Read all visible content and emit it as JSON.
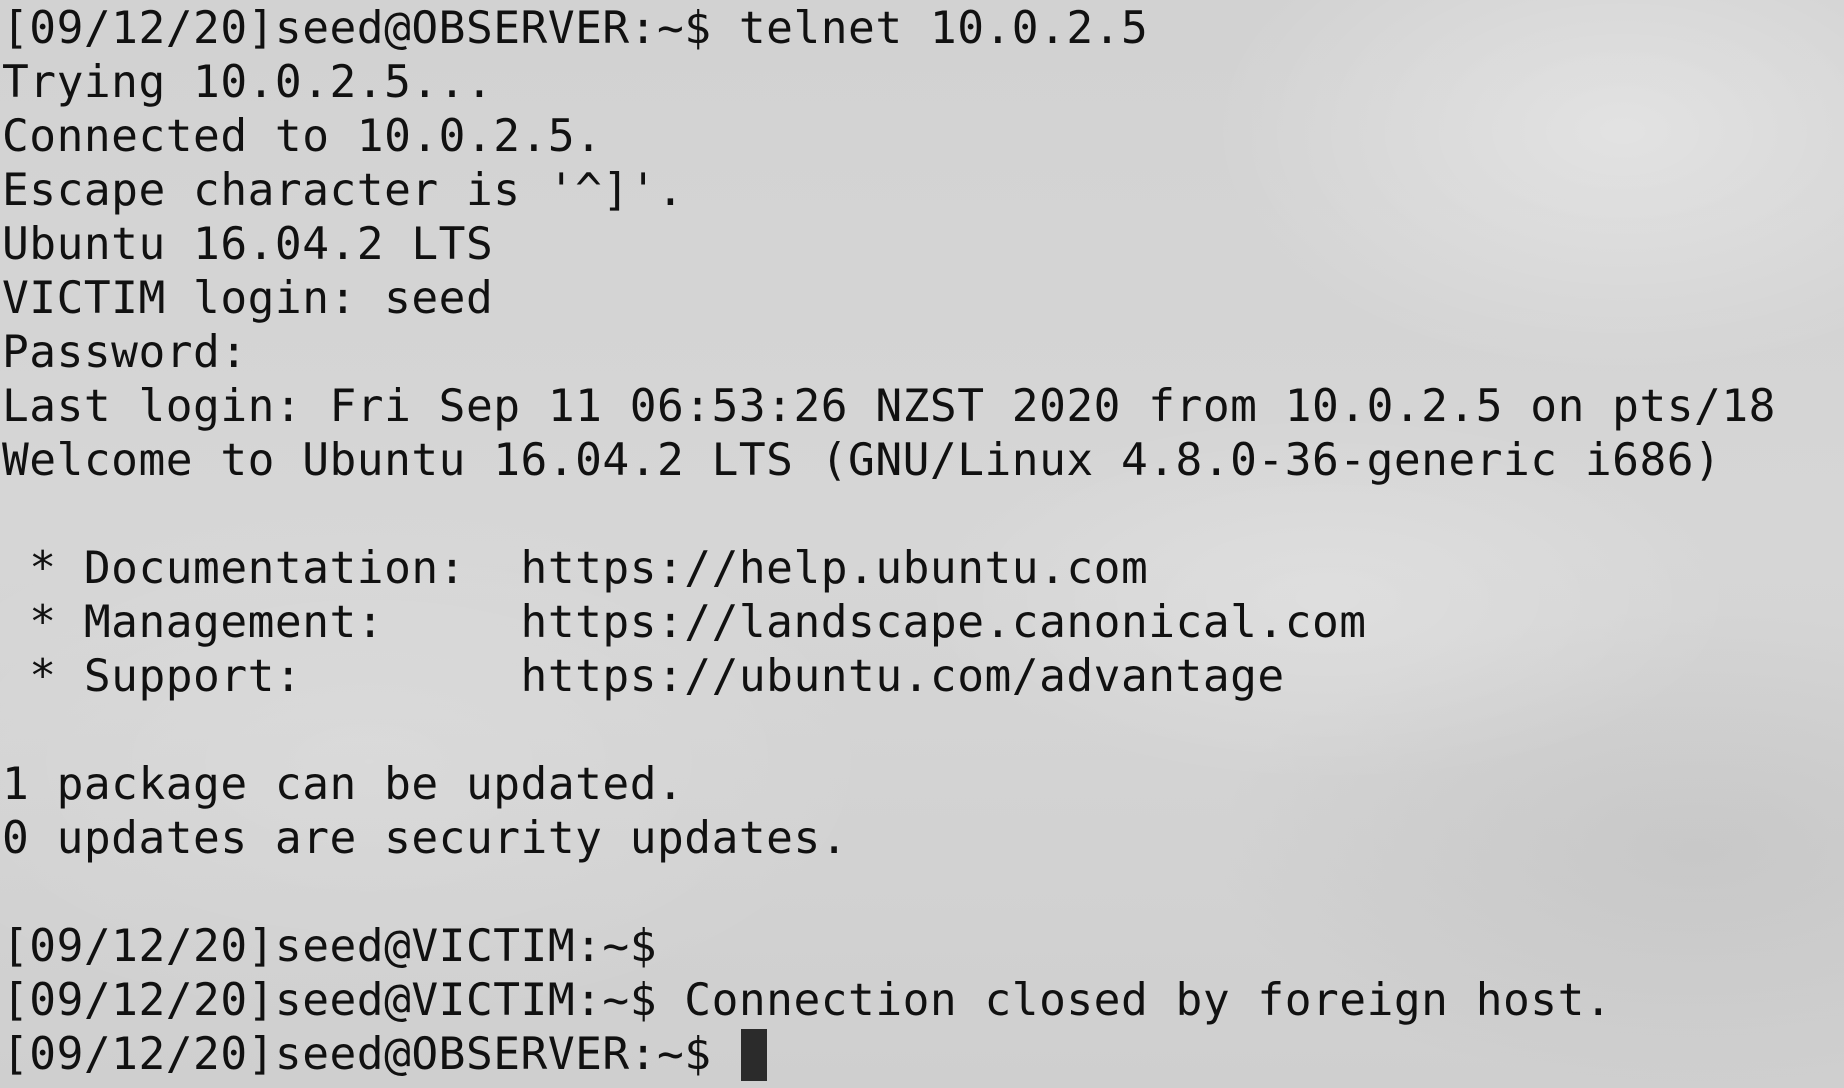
{
  "terminal": {
    "lines": [
      "[09/12/20]seed@OBSERVER:~$ telnet 10.0.2.5",
      "Trying 10.0.2.5...",
      "Connected to 10.0.2.5.",
      "Escape character is '^]'.",
      "Ubuntu 16.04.2 LTS",
      "VICTIM login: seed",
      "Password:",
      "Last login: Fri Sep 11 06:53:26 NZST 2020 from 10.0.2.5 on pts/18",
      "Welcome to Ubuntu 16.04.2 LTS (GNU/Linux 4.8.0-36-generic i686)",
      "",
      " * Documentation:  https://help.ubuntu.com",
      " * Management:     https://landscape.canonical.com",
      " * Support:        https://ubuntu.com/advantage",
      "",
      "1 package can be updated.",
      "0 updates are security updates.",
      "",
      "[09/12/20]seed@VICTIM:~$",
      "[09/12/20]seed@VICTIM:~$ Connection closed by foreign host.",
      "[09/12/20]seed@OBSERVER:~$ "
    ]
  },
  "colors": {
    "background": "#d4d4d4",
    "text": "#111111",
    "cursor": "#2b2b2b"
  }
}
